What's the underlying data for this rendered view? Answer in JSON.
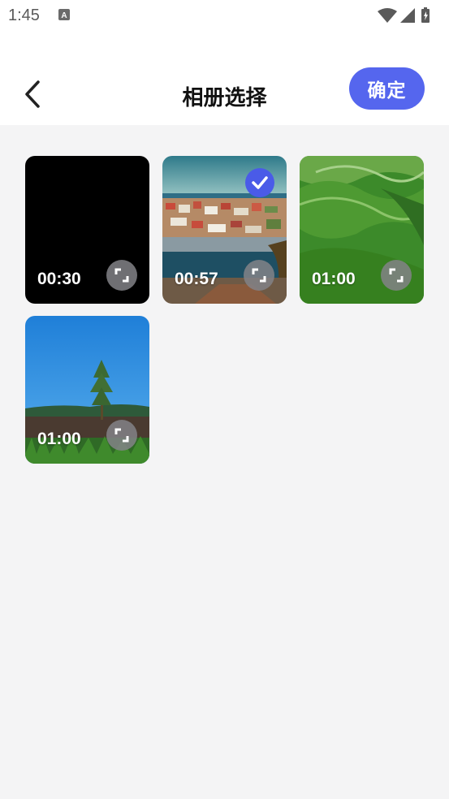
{
  "status": {
    "time": "1:45"
  },
  "header": {
    "title": "相册选择",
    "confirm_label": "确定"
  },
  "videos": [
    {
      "duration": "00:30",
      "selected": false,
      "scene": "black"
    },
    {
      "duration": "00:57",
      "selected": true,
      "scene": "coastal-town"
    },
    {
      "duration": "01:00",
      "selected": false,
      "scene": "green-hills"
    },
    {
      "duration": "01:00",
      "selected": false,
      "scene": "sky-tree"
    }
  ],
  "colors": {
    "accent": "#5566ee",
    "background": "#f4f4f5"
  }
}
